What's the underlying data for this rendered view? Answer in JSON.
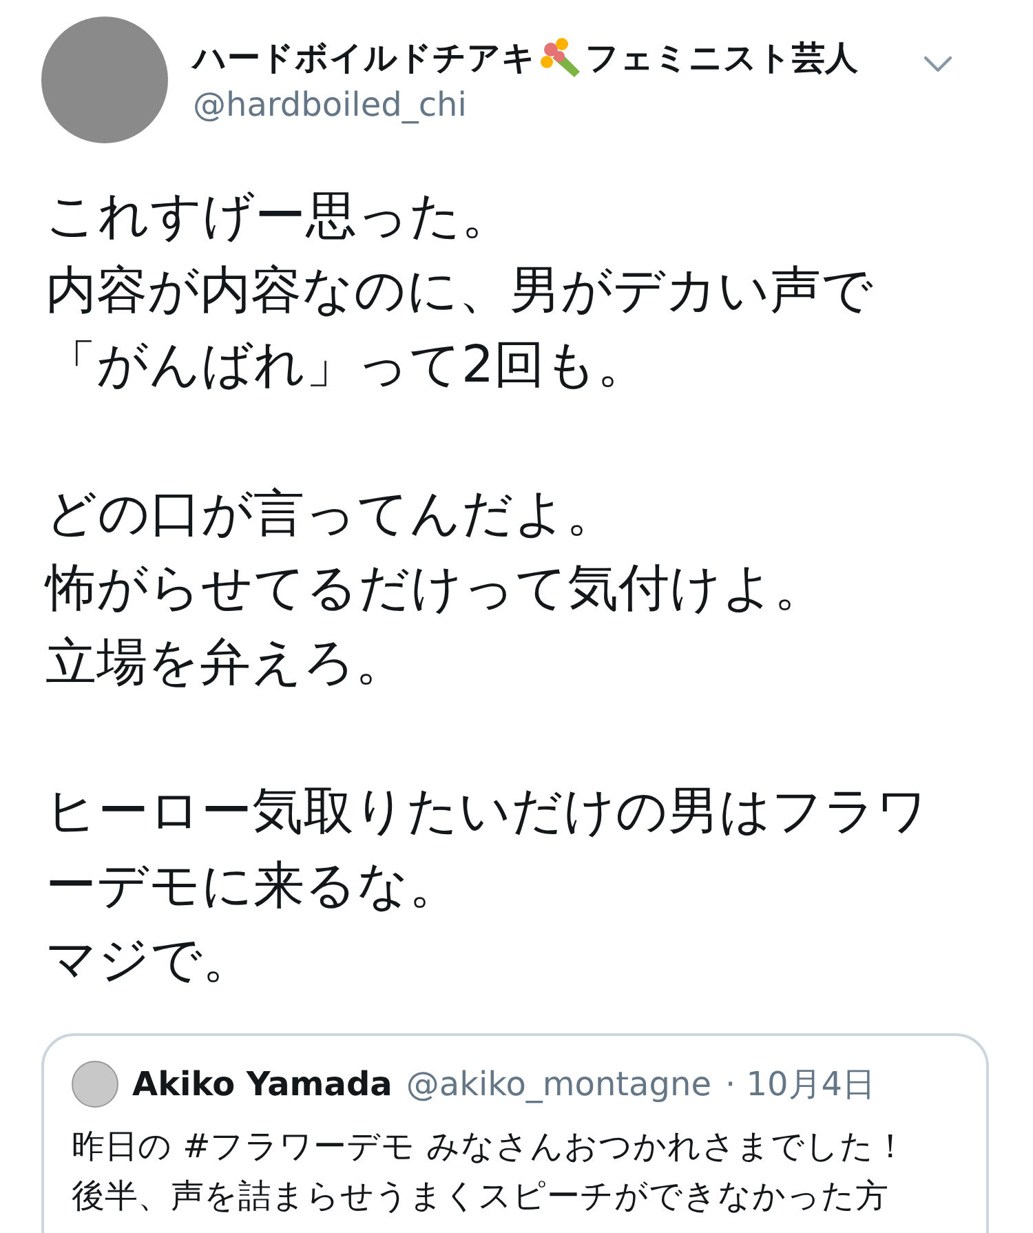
{
  "author": {
    "name_before_icon": "ハードボイルドチアキ",
    "name_after_icon": "フェミニスト芸人",
    "handle": "@hardboiled_chi"
  },
  "paragraphs": [
    [
      "これすげー思った。",
      "内容が内容なのに、男がデカい声で",
      "「がんばれ」って2回も。"
    ],
    [
      "どの口が言ってんだよ。",
      "怖がらせてるだけって気付けよ。",
      "立場を弁えろ。"
    ],
    [
      "ヒーロー気取りたいだけの男はフラワ",
      "ーデモに来るな。",
      "マジで。"
    ]
  ],
  "quoted": {
    "name": "Akiko Yamada",
    "handle": "@akiko_montagne",
    "date": "· 10月4日",
    "lines": [
      "昨日の #フラワーデモ みなさんおつかれさまでした！",
      "後半、声を詰まらせうまくスピーチができなかった方"
    ]
  }
}
